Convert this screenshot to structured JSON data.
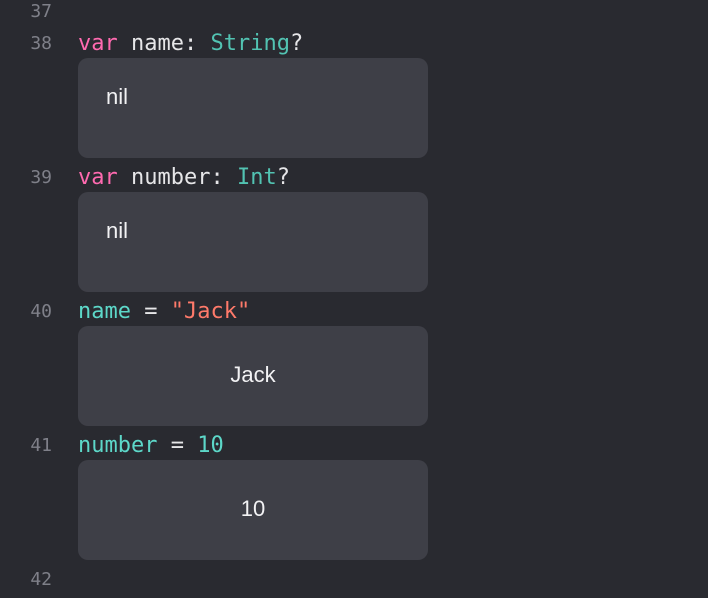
{
  "lines": [
    {
      "number": "37"
    },
    {
      "number": "38",
      "tokens": [
        "var",
        " name: ",
        "String",
        "?"
      ]
    },
    {
      "number": "39",
      "tokens": [
        "var",
        " number: ",
        "Int",
        "?"
      ]
    },
    {
      "number": "40",
      "tokens": [
        "name",
        " = ",
        "\"Jack\""
      ]
    },
    {
      "number": "41",
      "tokens": [
        "number",
        " = ",
        "10"
      ]
    },
    {
      "number": "42"
    }
  ],
  "results": [
    {
      "value": "nil"
    },
    {
      "value": "nil"
    },
    {
      "value": "Jack"
    },
    {
      "value": "10"
    }
  ],
  "colors": {
    "background": "#292a30",
    "keyword": "#ff6ab0",
    "type": "#52c3b2",
    "identifier": "#5dd8c9",
    "string": "#ff7a6a",
    "result_box": "#3e3f47"
  }
}
